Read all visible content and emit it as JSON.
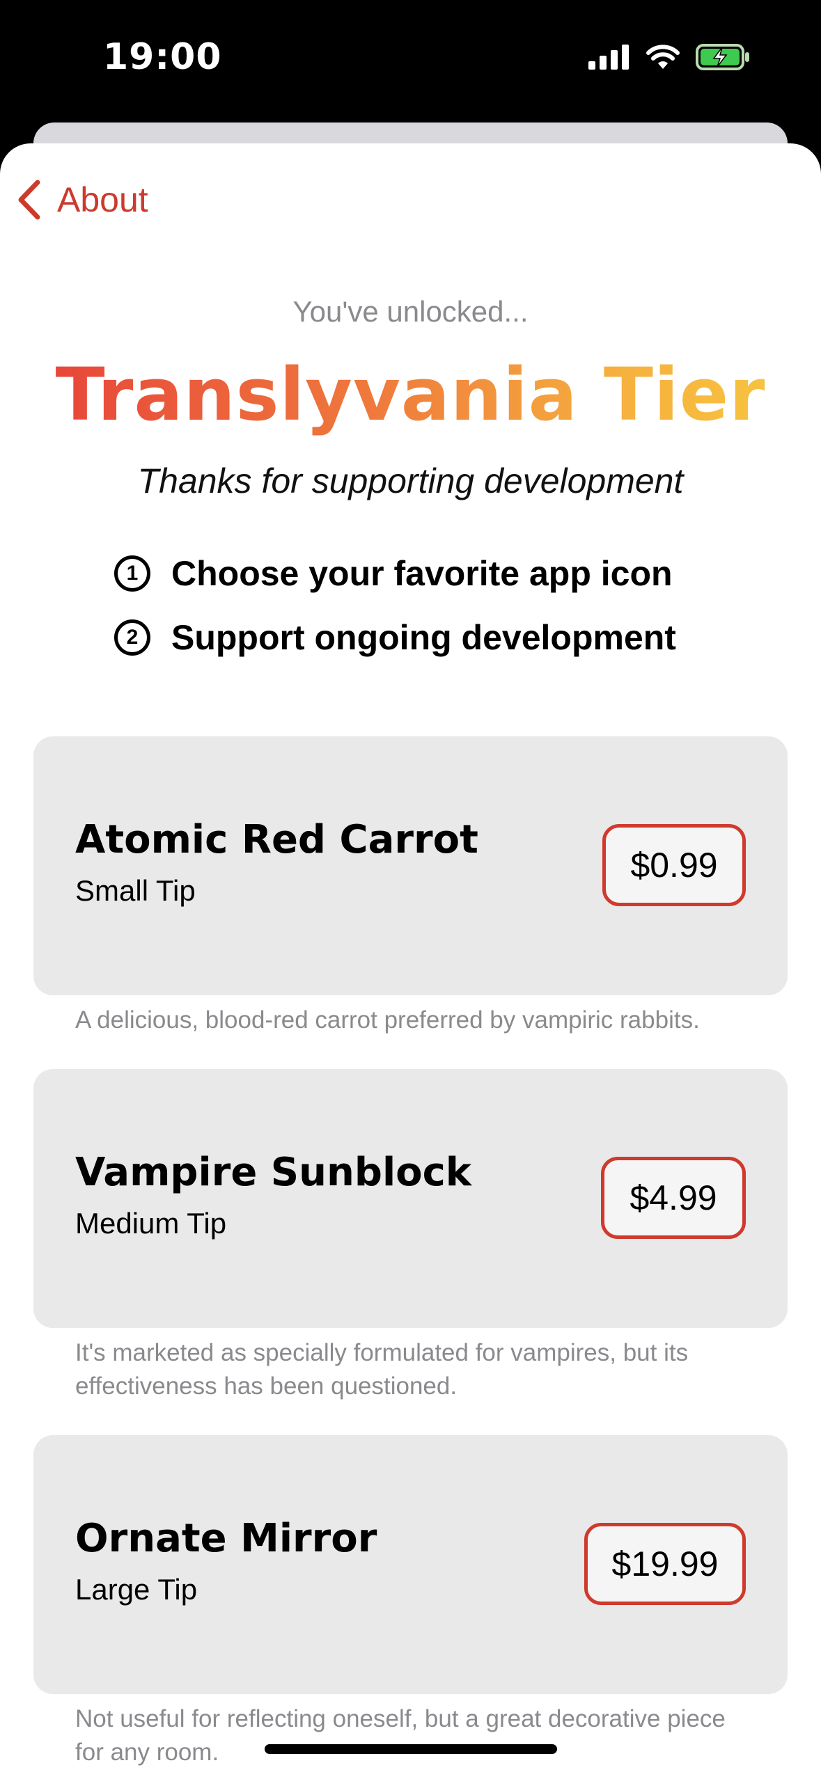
{
  "status_bar": {
    "time": "19:00"
  },
  "nav": {
    "back_label": "About"
  },
  "header": {
    "unlocked": "You've unlocked...",
    "tier_title": "Translyvania Tier",
    "thanks": "Thanks for supporting development"
  },
  "benefits": [
    {
      "num": "1",
      "text": "Choose your favorite app icon"
    },
    {
      "num": "2",
      "text": "Support ongoing development"
    }
  ],
  "tips": [
    {
      "title": "Atomic Red Carrot",
      "subtitle": "Small Tip",
      "price": "$0.99",
      "description": "A delicious, blood-red carrot preferred by vampiric rabbits."
    },
    {
      "title": "Vampire Sunblock",
      "subtitle": "Medium Tip",
      "price": "$4.99",
      "description": "It's marketed as specially formulated for vampires, but its effectiveness has been questioned."
    },
    {
      "title": "Ornate Mirror",
      "subtitle": "Large Tip",
      "price": "$19.99",
      "description": "Not useful for reflecting oneself, but a great decorative piece for any room."
    }
  ],
  "colors": {
    "accent": "#cc3a2c",
    "card_bg": "#e9e9ea",
    "gradient_start": "#e8473a",
    "gradient_end": "#f7c240"
  }
}
